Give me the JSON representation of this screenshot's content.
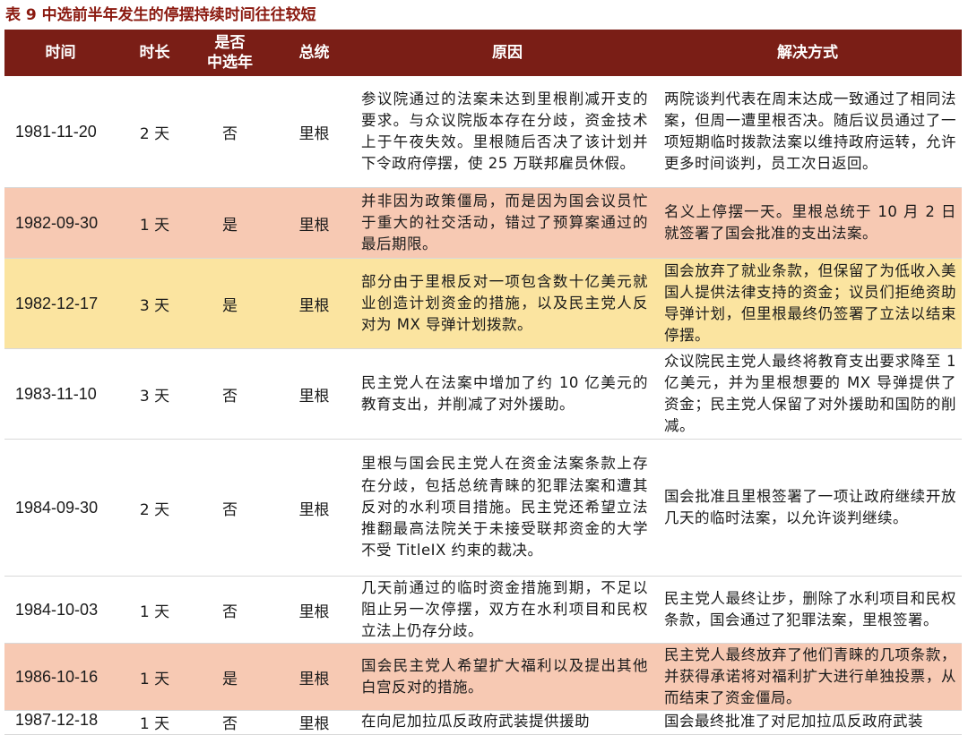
{
  "title": "表 9 中选前半年发生的停摆持续时间往往较短",
  "colors": {
    "header_bg": "#7a1e16",
    "title_color": "#8b1a10",
    "highlight_salmon": "#f7c9b3",
    "highlight_yellow": "#fbe4a0"
  },
  "columns": {
    "date": "时间",
    "duration": "时长",
    "midterm": "是否\n中选年",
    "president": "总统",
    "reason": "原因",
    "resolution": "解决方式"
  },
  "rows": [
    {
      "date": "1981-11-20",
      "duration": "2 天",
      "midterm": "否",
      "president": "里根",
      "reason": "参议院通过的法案未达到里根削减开支的要求。与众议院版本存在分歧，资金技术上于午夜失效。里根随后否决了该计划并下令政府停摆，使 25 万联邦雇员休假。",
      "resolution": "两院谈判代表在周末达成一致通过了相同法案，但周一遭里根否决。随后议员通过了一项短期临时拨款法案以维持政府运转，允许更多时间谈判，员工次日返回。",
      "highlight": "none"
    },
    {
      "date": "1982-09-30",
      "duration": "1 天",
      "midterm": "是",
      "president": "里根",
      "reason": "并非因为政策僵局，而是因为国会议员忙于重大的社交活动，错过了预算案通过的最后期限。",
      "resolution": "名义上停摆一天。里根总统于 10 月 2 日就签署了国会批准的支出法案。",
      "highlight": "salmon"
    },
    {
      "date": "1982-12-17",
      "duration": "3 天",
      "midterm": "是",
      "president": "里根",
      "reason": "部分由于里根反对一项包含数十亿美元就业创造计划资金的措施，以及民主党人反对为 MX 导弹计划拨款。",
      "resolution": "国会放弃了就业条款，但保留了为低收入美国人提供法律支持的资金；议员们拒绝资助导弹计划，但里根最终仍签署了立法以结束停摆。",
      "highlight": "yellow"
    },
    {
      "date": "1983-11-10",
      "duration": "3 天",
      "midterm": "否",
      "president": "里根",
      "reason": "民主党人在法案中增加了约 10 亿美元的教育支出，并削减了对外援助。",
      "resolution": "众议院民主党人最终将教育支出要求降至 1 亿美元，并为里根想要的 MX 导弹提供了资金；民主党人保留了对外援助和国防的削减。",
      "highlight": "none"
    },
    {
      "date": "1984-09-30",
      "duration": "2 天",
      "midterm": "否",
      "president": "里根",
      "reason": "里根与国会民主党人在资金法案条款上存在分歧，包括总统青睐的犯罪法案和遭其反对的水利项目措施。民主党还希望立法推翻最高法院关于未接受联邦资金的大学不受 TitleIX 约束的裁决。",
      "resolution": "国会批准且里根签署了一项让政府继续开放几天的临时法案，以允许谈判继续。",
      "highlight": "none"
    },
    {
      "date": "1984-10-03",
      "duration": "1 天",
      "midterm": "否",
      "president": "里根",
      "reason": "几天前通过的临时资金措施到期，不足以阻止另一次停摆，双方在水利项目和民权立法上仍存分歧。",
      "resolution": "民主党人最终让步，删除了水利项目和民权条款，国会通过了犯罪法案，里根签署。",
      "highlight": "none"
    },
    {
      "date": "1986-10-16",
      "duration": "1 天",
      "midterm": "是",
      "president": "里根",
      "reason": "国会民主党人希望扩大福利以及提出其他白宫反对的措施。",
      "resolution": "民主党人最终放弃了他们青睐的几项条款，并获得承诺将对福利扩大进行单独投票，从而结束了资金僵局。",
      "highlight": "salmon"
    },
    {
      "date": "1987-12-18",
      "duration": "1 天",
      "midterm": "否",
      "president": "里根",
      "reason": "在向尼加拉瓜反政府武装提供援助",
      "resolution": "国会最终批准了对尼加拉瓜反政府武装",
      "highlight": "none"
    }
  ]
}
